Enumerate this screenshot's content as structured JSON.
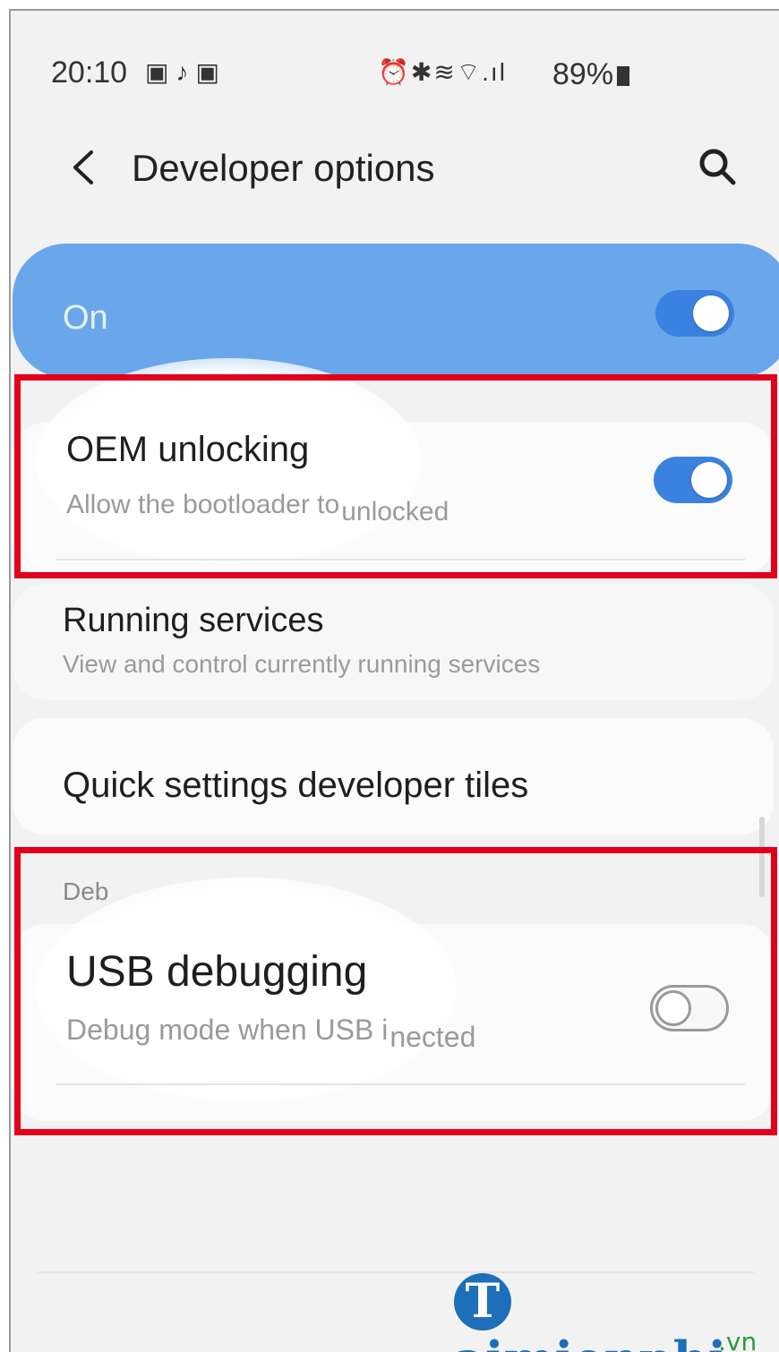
{
  "status_bar": {
    "time": "20:10",
    "left_icons": [
      "gallery-icon",
      "music-icon",
      "cast-icon"
    ],
    "right_icons": [
      "alarm-icon",
      "bluetooth-icon",
      "nfc-icon",
      "wifi-icon",
      "signal-icon"
    ],
    "battery": "89%"
  },
  "header": {
    "title": "Developer options"
  },
  "master": {
    "label": "On",
    "enabled": true
  },
  "items": {
    "oem": {
      "title": "OEM unlocking",
      "subtitle_a": "Allow the bootloader to",
      "subtitle_b": "unlocked",
      "enabled": true
    },
    "running": {
      "title": "Running services",
      "subtitle": "View and control currently running services"
    },
    "quick": {
      "title": "Quick settings developer tiles"
    },
    "debug_section": "Deb",
    "usb": {
      "title": "USB debugging",
      "subtitle_a": "Debug mode when USB i",
      "subtitle_b": "nected",
      "enabled": false
    }
  },
  "watermark": {
    "logo_letter": "T",
    "logo_text": "aimienphi",
    "suffix": ".vn"
  },
  "colors": {
    "accent": "#3b82e0",
    "master_bg": "#6aa7ea",
    "highlight": "#e3001b"
  }
}
